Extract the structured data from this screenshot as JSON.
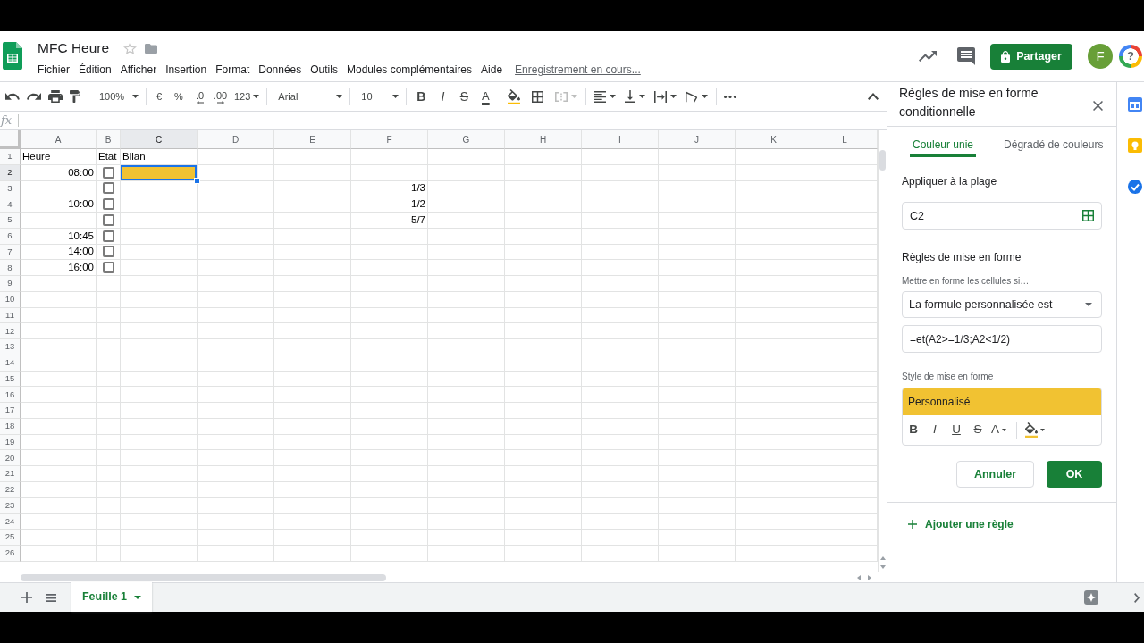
{
  "document": {
    "title": "MFC Heure",
    "starred": false
  },
  "menu": [
    "Fichier",
    "Édition",
    "Afficher",
    "Insertion",
    "Format",
    "Données",
    "Outils",
    "Modules complémentaires",
    "Aide"
  ],
  "save_status": "Enregistrement en cours...",
  "header_actions": {
    "share_button": "Partager",
    "avatar": "F",
    "help_button": "?"
  },
  "toolbar": {
    "zoom": "100%",
    "currency": "€",
    "percent": "%",
    "decrease_decimals": ".0",
    "increase_decimals": ".00",
    "number_format": "123",
    "font": "Arial",
    "font_size": "10",
    "text_styles": [
      "B",
      "I",
      "S",
      "A"
    ],
    "merge_disabled": true
  },
  "formula_bar": {
    "label": "fx"
  },
  "sheet": {
    "columns": [
      "A",
      "B",
      "C",
      "D",
      "E",
      "F",
      "G",
      "H",
      "I",
      "J",
      "K",
      "L"
    ],
    "rows": [
      {
        "number": "1",
        "cells": [
          {
            "kind": "text",
            "text": "Heure",
            "right_aligned": false,
            "selected": false
          },
          {
            "kind": "text",
            "text": "Etat",
            "right_aligned": false,
            "selected": false
          },
          {
            "kind": "text",
            "text": "Bilan",
            "right_aligned": false,
            "selected": false
          }
        ]
      },
      {
        "number": "2",
        "cells": [
          {
            "kind": "text",
            "text": "08:00",
            "right_aligned": true,
            "selected": false
          },
          {
            "kind": "checkbox",
            "checked": false,
            "selected": false
          },
          {
            "kind": "empty",
            "selected": true,
            "color": "#f1c232"
          }
        ]
      },
      {
        "number": "3",
        "cells": [
          {
            "kind": "empty",
            "selected": false
          },
          {
            "kind": "checkbox",
            "checked": false,
            "selected": false
          },
          {
            "kind": "empty",
            "selected": false
          },
          {
            "kind": "empty",
            "selected": false
          },
          {
            "kind": "empty",
            "selected": false
          },
          {
            "kind": "text",
            "text": "1/3",
            "right_aligned": true,
            "selected": false
          }
        ]
      },
      {
        "number": "4",
        "cells": [
          {
            "kind": "text",
            "text": "10:00",
            "right_aligned": true,
            "selected": false
          },
          {
            "kind": "checkbox",
            "checked": false,
            "selected": false
          },
          {
            "kind": "empty",
            "selected": false
          },
          {
            "kind": "empty",
            "selected": false
          },
          {
            "kind": "empty",
            "selected": false
          },
          {
            "kind": "text",
            "text": "1/2",
            "right_aligned": true,
            "selected": false
          }
        ]
      },
      {
        "number": "5",
        "cells": [
          {
            "kind": "empty",
            "selected": false
          },
          {
            "kind": "checkbox",
            "checked": false,
            "selected": false
          },
          {
            "kind": "empty",
            "selected": false
          },
          {
            "kind": "empty",
            "selected": false
          },
          {
            "kind": "empty",
            "selected": false
          },
          {
            "kind": "text",
            "text": "5/7",
            "right_aligned": true,
            "selected": false
          }
        ]
      },
      {
        "number": "6",
        "cells": [
          {
            "kind": "text",
            "text": "10:45",
            "right_aligned": true,
            "selected": false
          },
          {
            "kind": "checkbox",
            "checked": false,
            "selected": false
          }
        ]
      },
      {
        "number": "7",
        "cells": [
          {
            "kind": "text",
            "text": "14:00",
            "right_aligned": true,
            "selected": false
          },
          {
            "kind": "checkbox",
            "checked": false,
            "selected": false
          }
        ]
      },
      {
        "number": "8",
        "cells": [
          {
            "kind": "text",
            "text": "16:00",
            "right_aligned": true,
            "selected": false
          },
          {
            "kind": "checkbox",
            "checked": false,
            "selected": false
          }
        ]
      },
      {
        "number": "9"
      },
      {
        "number": "10"
      },
      {
        "number": "11"
      },
      {
        "number": "12"
      },
      {
        "number": "13"
      },
      {
        "number": "14"
      },
      {
        "number": "15"
      },
      {
        "number": "16"
      },
      {
        "number": "17"
      },
      {
        "number": "18"
      },
      {
        "number": "19"
      },
      {
        "number": "20"
      },
      {
        "number": "21"
      },
      {
        "number": "22"
      },
      {
        "number": "23"
      },
      {
        "number": "24"
      },
      {
        "number": "25"
      },
      {
        "number": "26"
      }
    ]
  },
  "panel": {
    "title": "Règles de mise en forme conditionnelle",
    "tabs": [
      {
        "label": "Couleur unie",
        "selected": true
      },
      {
        "label": "Dégradé de couleurs",
        "selected": false
      }
    ],
    "range_label": "Appliquer à la plage",
    "range": "C2",
    "rules_heading": "Règles de mise en forme",
    "condition_label": "Mettre en forme les cellules si…",
    "condition": "La formule personnalisée est",
    "formula": "=et(A2>=1/3;A2<1/2)",
    "style_label": "Style de mise en forme",
    "style_preview": "Personnalisé",
    "style_buttons": [
      "B",
      "I",
      "U",
      "S",
      "A"
    ],
    "cancel_button": "Annuler",
    "ok_button": "OK",
    "add_rule": "Ajouter une règle"
  },
  "sheet_tabs": [
    {
      "label": "Feuille 1",
      "selected": true
    }
  ]
}
